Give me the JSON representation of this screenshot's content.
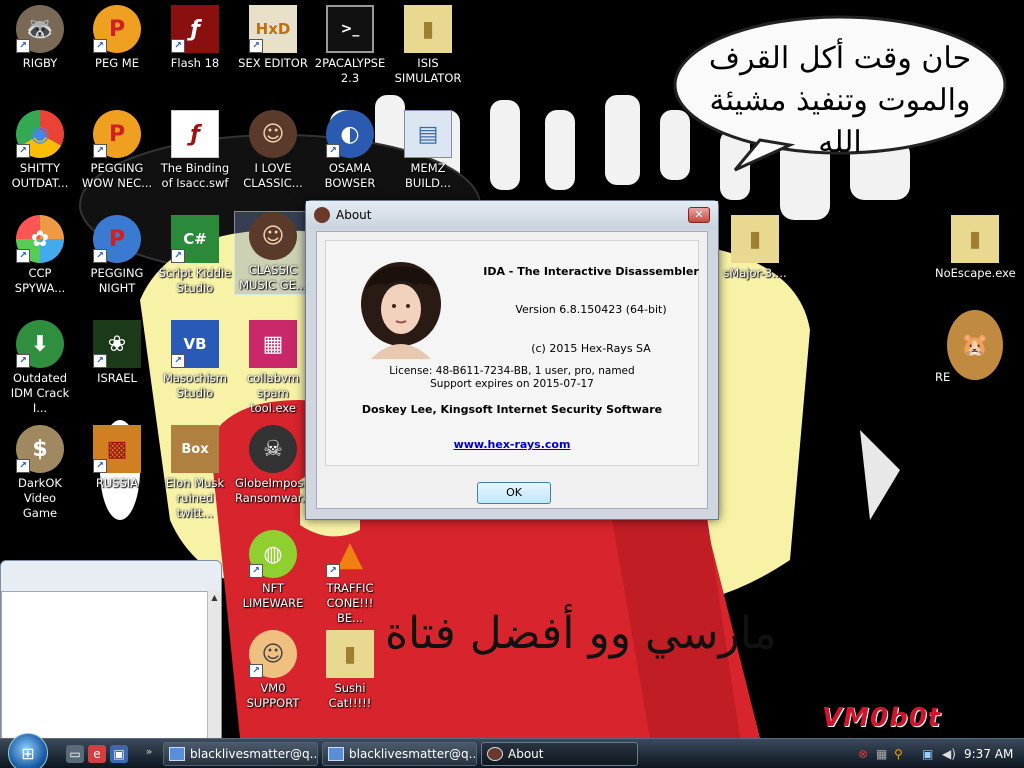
{
  "wallpaper": {
    "bubble_line1": "حان وقت أكل القرف",
    "bubble_line2": "والموت وتنفيذ مشيئة الله",
    "bottom_text": "مارسي وو أفضل فتاة",
    "watermark": "VM0b0t"
  },
  "desktop_icons": [
    {
      "label": "RIGBY",
      "glyph": "🦝"
    },
    {
      "label": "PEG ME",
      "glyph": "P"
    },
    {
      "label": "Flash 18",
      "glyph": "ƒ"
    },
    {
      "label": "SEX EDITOR",
      "glyph": "HxD"
    },
    {
      "label": "2PACALYPSE\n2.3",
      "glyph": ">_"
    },
    {
      "label": "ISIS\nSIMULATOR",
      "glyph": "▮"
    },
    {
      "label": "SHITTY\nOUTDAT...",
      "glyph": "◉"
    },
    {
      "label": "PEGGING\nWOW NEC...",
      "glyph": "P"
    },
    {
      "label": "The Binding\nof Isacc.swf",
      "glyph": "ƒ"
    },
    {
      "label": "I LOVE\nCLASSIC...",
      "glyph": "☺"
    },
    {
      "label": "OSAMA\nBOWSER",
      "glyph": "◐"
    },
    {
      "label": "MEMZ\nBUILD...",
      "glyph": "▤"
    },
    {
      "label": "CCP\nSPYWA...",
      "glyph": "✿"
    },
    {
      "label": "PEGGING\nNIGHT",
      "glyph": "P"
    },
    {
      "label": "Script Kiddie\nStudio",
      "glyph": "C#"
    },
    {
      "label": "CLASSIC\nMUSIC GE...",
      "glyph": "☺"
    },
    {
      "label": "sMajor-3....",
      "glyph": "▮"
    },
    {
      "label": "NoEscape.exe",
      "glyph": "▮"
    },
    {
      "label": "Outdated\nIDM Crack I...",
      "glyph": "⬇"
    },
    {
      "label": "ISRAEL",
      "glyph": "❀"
    },
    {
      "label": "Masochism\nStudio",
      "glyph": "VB"
    },
    {
      "label": "collabvm\nspam tool.exe",
      "glyph": "▦"
    },
    {
      "label": "RE",
      "glyph": "🐹"
    },
    {
      "label": "DarkOK Video\nGame",
      "glyph": "$"
    },
    {
      "label": "RUSSIA",
      "glyph": "▩"
    },
    {
      "label": "Elon Musk\nruined twitt...",
      "glyph": "Box"
    },
    {
      "label": "GlobeImpos...\nRansomwar...",
      "glyph": "☠"
    },
    {
      "label": "NFT\nLIMEWARE",
      "glyph": "◍"
    },
    {
      "label": "TRAFFIC\nCONE!!! BE...",
      "glyph": "▲"
    },
    {
      "label": "VM0\nSUPPORT",
      "glyph": "☺"
    },
    {
      "label": "Sushi Cat!!!!!",
      "glyph": "▮"
    }
  ],
  "about_dialog": {
    "title": "About",
    "product": "IDA - The Interactive Disassembler",
    "version": "Version 6.8.150423 (64-bit)",
    "copyright": "(c) 2015 Hex-Rays SA",
    "license_line1": "License: 48-B611-7234-BB, 1 user, pro, named",
    "license_line2": "Support expires on 2015-07-17",
    "owner": "Doskey Lee, Kingsoft Internet Security Software",
    "link": "www.hex-rays.com",
    "ok_label": "OK",
    "close_glyph": "✕"
  },
  "taskbar": {
    "start_glyph": "⊞",
    "buttons": [
      {
        "label": "blacklivesmatter@q..."
      },
      {
        "label": "blacklivesmatter@q..."
      },
      {
        "label": "About"
      }
    ],
    "clock": "9:37 AM"
  }
}
